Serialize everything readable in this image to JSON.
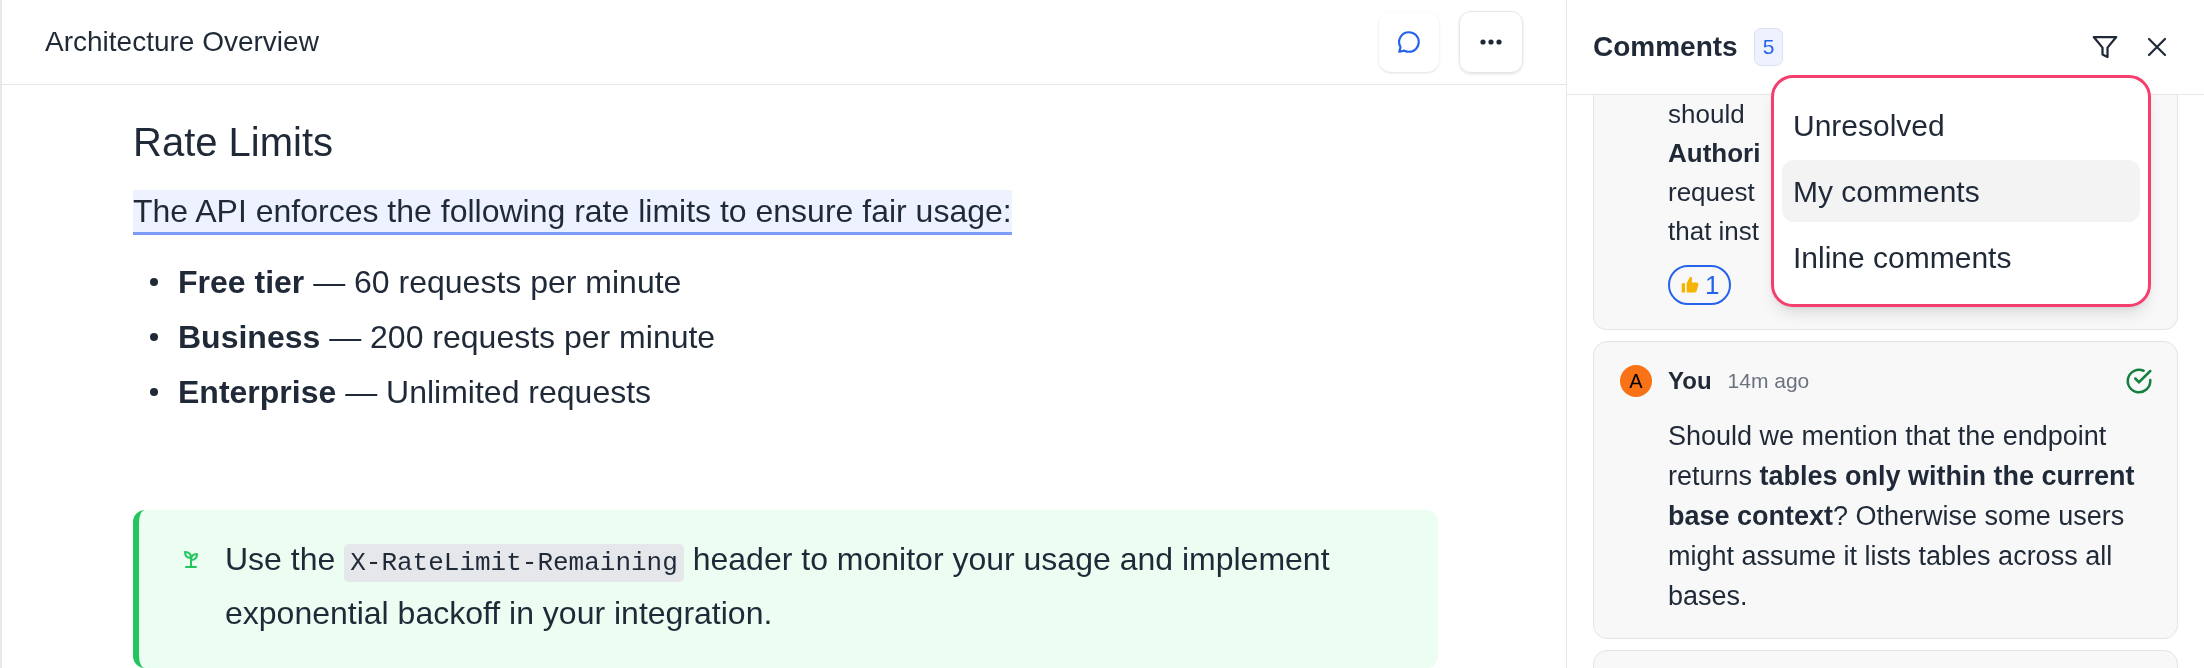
{
  "document": {
    "title": "Architecture Overview",
    "comments_toggle": {
      "active": true
    },
    "heading": "Rate Limits",
    "intro": {
      "text": "The API enforces the following rate limits to ensure fair usage:",
      "highlighted": true
    },
    "bullets": [
      "**Free tier** — 60 requests per minute",
      "**Business** — 200 requests per minute",
      "**Enterprise** — Unlimited requests"
    ],
    "callout": {
      "parts": [
        {
          "kind": "text",
          "text": "Use the "
        },
        {
          "kind": "code",
          "text": "X-RateLimit-Remaining"
        },
        {
          "kind": "text",
          "text": " header to monitor your usage and implement exponential backoff in your integration."
        }
      ]
    }
  },
  "comments_panel": {
    "title": "Comments",
    "count": "5",
    "filter_menu": [
      {
        "label": "Unresolved",
        "selected": false
      },
      {
        "label": "My comments",
        "selected": true
      },
      {
        "label": "Inline comments",
        "selected": false
      }
    ],
    "comments": [
      {
        "kind": "partial",
        "lines": [
          {
            "text": "should",
            "bold": false
          },
          {
            "text": "Authori",
            "bold": true
          },
          {
            "text": "request",
            "bold": false
          },
          {
            "text": "that inst",
            "bold": false
          }
        ],
        "reactions": [
          {
            "count": "1",
            "selected": true
          }
        ]
      },
      {
        "kind": "full",
        "avatar": "A",
        "author": "You",
        "time": "14m ago",
        "resolved": true,
        "text": "Should we mention that the endpoint returns **tables only within the current base context**? Otherwise some users might assume it lists tables across all bases."
      }
    ]
  }
}
